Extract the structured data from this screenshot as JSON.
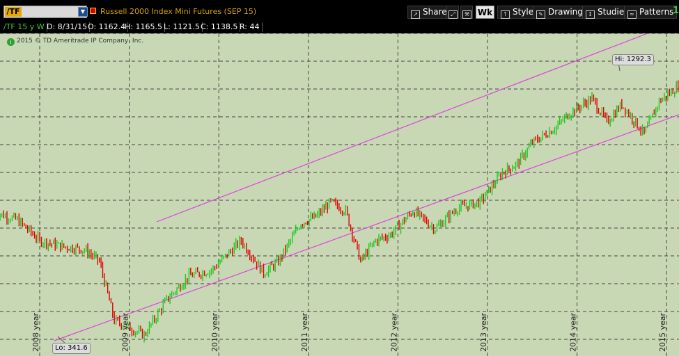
{
  "toolbar": {
    "symbol": "/TF",
    "instrument_title": "Russell 2000 Index Mini Futures (SEP 15)",
    "share_label": "Share",
    "wk_label": "Wk",
    "style_label": "Style",
    "drawings_label": "Drawings",
    "studies_label": "Studies",
    "patterns_label": "Patterns",
    "right_indicator": "1"
  },
  "info_bar": {
    "symbol_period": "/TF 15 y W",
    "date": "D: 8/31/15",
    "open": "O: 1162.4",
    "high": "H: 1165.5",
    "low": "L: 1121.5",
    "close": "C: 1138.5",
    "range": "R: 44"
  },
  "copyright": "2015 © TD Ameritrade IP Company, Inc.",
  "colors": {
    "background": "#c8d8b4",
    "up": "#1ec81e",
    "down": "#e00000",
    "channel": "#e040e0",
    "grid": "#444444"
  },
  "chart_data": {
    "type": "line",
    "x_tick_labels": [
      "2008 year",
      "2009 year",
      "2010 year",
      "2011 year",
      "2012 year",
      "2013 year",
      "2014 year",
      "2015 year"
    ],
    "x": [
      "2007-07",
      "2007-10",
      "2008-01",
      "2008-04",
      "2008-07",
      "2008-09",
      "2008-11",
      "2009-03",
      "2009-06",
      "2009-09",
      "2009-12",
      "2010-04",
      "2010-07",
      "2010-09",
      "2010-12",
      "2011-02",
      "2011-04",
      "2011-06",
      "2011-08",
      "2011-10",
      "2011-12",
      "2012-03",
      "2012-06",
      "2012-09",
      "2012-12",
      "2013-03",
      "2013-05",
      "2013-07",
      "2013-10",
      "2013-12",
      "2014-03",
      "2014-05",
      "2014-07",
      "2014-10",
      "2014-12",
      "2015-03",
      "2015-06",
      "2015-08"
    ],
    "close": [
      815,
      790,
      720,
      700,
      690,
      650,
      450,
      400,
      520,
      600,
      620,
      720,
      610,
      650,
      780,
      800,
      850,
      820,
      650,
      720,
      740,
      820,
      760,
      830,
      850,
      950,
      980,
      1050,
      1100,
      1150,
      1200,
      1120,
      1180,
      1080,
      1190,
      1250,
      1270,
      1140
    ],
    "high_label": "Hi: 1292.3",
    "low_label": "Lo: 341.6",
    "high_value": 1292.3,
    "low_value": 341.6,
    "ylim": [
      330,
      1420
    ],
    "grid": true,
    "channel_lines": true
  }
}
